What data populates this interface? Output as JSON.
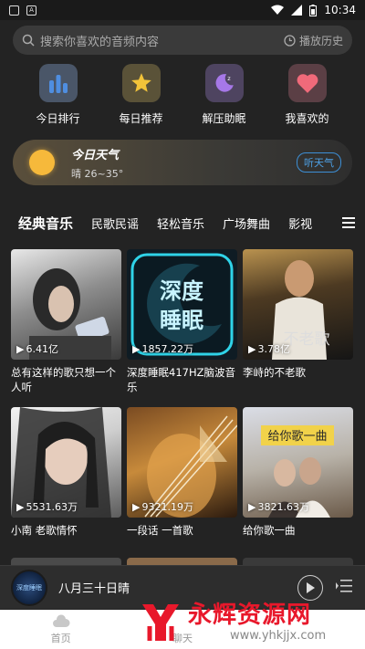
{
  "status_bar": {
    "time": "10:34"
  },
  "search": {
    "placeholder": "搜索你喜欢的音频内容",
    "history_label": "播放历史"
  },
  "quick_actions": [
    {
      "label": "今日排行",
      "icon": "bar-chart-icon",
      "color": "#4f8ee0"
    },
    {
      "label": "每日推荐",
      "icon": "star-icon",
      "color": "#f2c339"
    },
    {
      "label": "解压助眠",
      "icon": "moon-icon",
      "color": "#a678e8"
    },
    {
      "label": "我喜欢的",
      "icon": "heart-icon",
      "color": "#f06a7a"
    }
  ],
  "weather": {
    "title": "今日天气",
    "detail": "晴 26~35°",
    "button": "听天气"
  },
  "tabs": [
    "经典音乐",
    "民歌民谣",
    "轻松音乐",
    "广场舞曲",
    "影视"
  ],
  "cards": [
    {
      "title": "总有这样的歌只想一个人听",
      "plays": "6.41亿"
    },
    {
      "title": "深度睡眠417HZ脑波音乐",
      "plays": "1857.22万",
      "cover_text": "深度睡眠"
    },
    {
      "title": "李峙的不老歌",
      "plays": "3.78亿",
      "cover_text": "李峙的不老歌"
    },
    {
      "title": "小南 老歌情怀",
      "plays": "5531.63万"
    },
    {
      "title": "一段话 一首歌",
      "plays": "9321.19万"
    },
    {
      "title": "给你歌一曲",
      "plays": "3821.63万",
      "cover_text": "给你歌一曲"
    }
  ],
  "player": {
    "track": "八月三十日晴",
    "disc_text": "深度睡眠"
  },
  "bottom_nav": [
    {
      "label": "首页"
    },
    {
      "label": "聊天"
    },
    {
      "label": ""
    }
  ],
  "watermark": {
    "title": "永辉资源网",
    "url": "www.yhkjjx.com"
  }
}
